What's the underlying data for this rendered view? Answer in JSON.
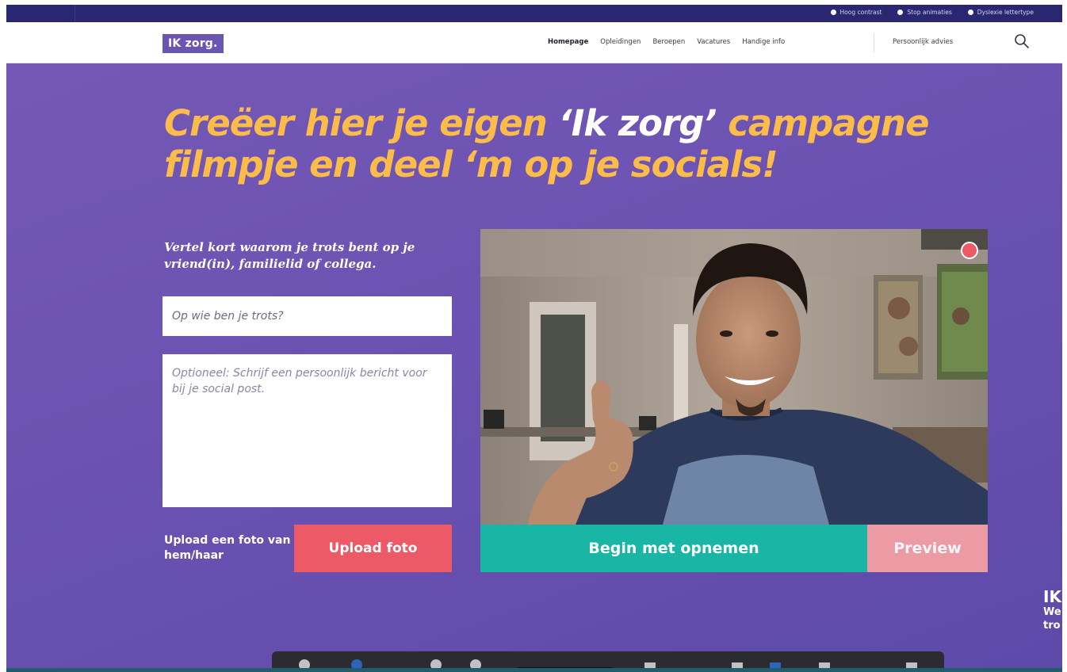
{
  "utility_bar": {
    "items": [
      {
        "label": "Hoog contrast",
        "icon": "contrast-icon"
      },
      {
        "label": "Stop animaties",
        "icon": "pause-icon"
      },
      {
        "label": "Dyslexie lettertype",
        "icon": "font-icon"
      }
    ]
  },
  "header": {
    "logo": "IK zorg.",
    "nav": [
      {
        "label": "Homepage",
        "active": true
      },
      {
        "label": "Opleidingen",
        "active": false
      },
      {
        "label": "Beroepen",
        "active": false
      },
      {
        "label": "Vacatures",
        "active": false
      },
      {
        "label": "Handige info",
        "active": false
      }
    ],
    "advice": "Persoonlijk advies",
    "search_icon": "search-icon"
  },
  "hero": {
    "headline_part1": "Creëer hier je eigen ",
    "headline_highlight": "‘Ik zorg’",
    "headline_part2": " campagne filmpje en deel ‘m op je socials!",
    "intro": "Vertel kort waarom je trots bent op je vriend(in), familielid of collega.",
    "who_placeholder": "Op wie ben je trots?",
    "message_placeholder": "Optioneel: Schrijf een persoonlijk bericht voor bij je social post.",
    "upload_label": "Upload een foto van hem/haar",
    "upload_button": "Upload foto",
    "record_button": "Begin met opnemen",
    "preview_button": "Preview",
    "video_icon": "camera-preview",
    "record_indicator_icon": "recording-dot-icon"
  },
  "edge": {
    "big": "IK",
    "line1": "We",
    "line2": "tro"
  },
  "colors": {
    "purple": "#6b52b2",
    "yellow": "#fbbc4a",
    "teal": "#19b6a6",
    "coral": "#ec5a68",
    "pink": "#f4a0a5",
    "navy": "#2a2670"
  }
}
